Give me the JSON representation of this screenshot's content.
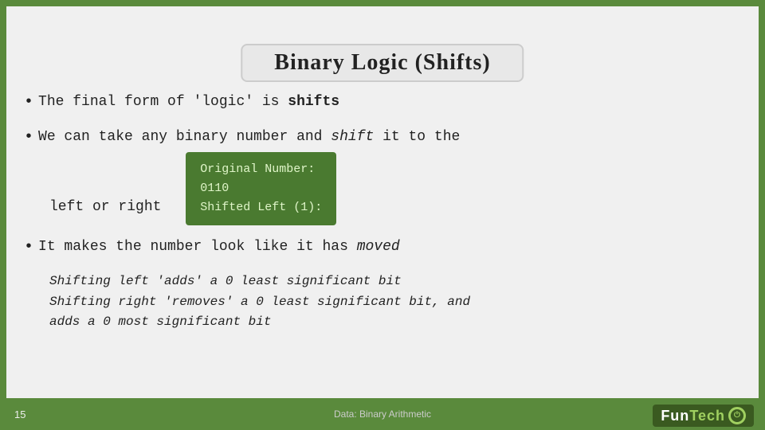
{
  "title": "Binary Logic  (Shifts)",
  "bullets": [
    {
      "id": "bullet1",
      "text": "The final form of 'logic' is ",
      "bold_suffix": "shifts"
    },
    {
      "id": "bullet2",
      "line1": "We can take any binary number and ",
      "italic_part": "shift",
      "line1_suffix": " it to the",
      "line2": "left or right"
    },
    {
      "id": "bullet3",
      "line1": "It makes the ",
      "bold_part": "the",
      "line1_rest": "number look like it has ",
      "italic_end": "moved",
      "indent1": "Shifting left 'adds' a 0 least significant bit",
      "indent2": "Shifting right 'removes' a 0 least significant bit, and",
      "indent3": "adds a 0 most significant bit"
    }
  ],
  "green_box": {
    "line1": "Original Number:",
    "line2": "0110",
    "line3": "Shifted Left (1):"
  },
  "footer": {
    "page_number": "15",
    "center_text": "Data: Binary Arithmetic"
  },
  "logo": {
    "fun": "Fun",
    "tech": "Tech"
  }
}
